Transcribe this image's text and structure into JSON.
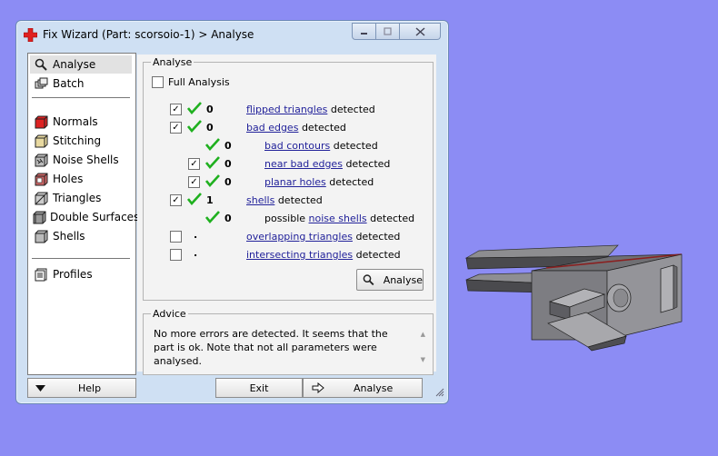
{
  "window": {
    "title": "Fix Wizard (Part: scorsoio-1) > Analyse",
    "controls": {
      "minimize": "minimize-icon",
      "maximize": "maximize-icon",
      "close": "close-icon"
    },
    "title_icon": "red-cross-icon"
  },
  "sidebar": {
    "items": [
      {
        "label": "Analyse",
        "icon": "search-icon",
        "active": true
      },
      {
        "label": "Batch",
        "icon": "batch-icon"
      },
      {
        "label": "Normals",
        "icon": "normals-cube-icon"
      },
      {
        "label": "Stitching",
        "icon": "stitching-cube-icon"
      },
      {
        "label": "Noise Shells",
        "icon": "noise-shells-icon"
      },
      {
        "label": "Holes",
        "icon": "holes-cube-icon"
      },
      {
        "label": "Triangles",
        "icon": "triangles-cube-icon"
      },
      {
        "label": "Double Surfaces",
        "icon": "double-surfaces-icon"
      },
      {
        "label": "Shells",
        "icon": "shells-cube-icon"
      },
      {
        "label": "Profiles",
        "icon": "profiles-icon"
      }
    ]
  },
  "analyse": {
    "group_label": "Analyse",
    "full_analysis_label": "Full Analysis",
    "full_analysis_checked": false,
    "rows": [
      {
        "checked": true,
        "status": "ok",
        "count": "0",
        "link": "flipped triangles",
        "suffix": "detected"
      },
      {
        "checked": true,
        "status": "ok",
        "count": "0",
        "link": "bad edges",
        "suffix": "detected"
      },
      {
        "checked": null,
        "status": "ok",
        "count": "0",
        "link": "bad contours",
        "suffix": "detected"
      },
      {
        "checked": true,
        "status": "ok",
        "count": "0",
        "link": "near bad edges",
        "suffix": "detected"
      },
      {
        "checked": true,
        "status": "ok",
        "count": "0",
        "link": "planar holes",
        "suffix": "detected"
      },
      {
        "checked": true,
        "status": "ok",
        "count": "1",
        "link": "shells",
        "suffix": "detected"
      },
      {
        "checked": null,
        "status": "ok",
        "count": "0",
        "prefix": "possible",
        "link": "noise shells",
        "suffix": "detected"
      },
      {
        "checked": false,
        "status": "none",
        "count": ".",
        "link": "overlapping triangles",
        "suffix": "detected"
      },
      {
        "checked": false,
        "status": "none",
        "count": ".",
        "link": "intersecting triangles",
        "suffix": "detected"
      }
    ],
    "analyse_button": "Analyse"
  },
  "advice": {
    "group_label": "Advice",
    "text": "No more errors are detected. It seems that the part is ok. Note that not all parameters were analysed."
  },
  "bottom": {
    "help": "Help",
    "exit": "Exit",
    "analyse": "Analyse"
  },
  "colors": {
    "desktop": "#8c8cf4",
    "check_green": "#1fb01f",
    "link": "#22229a",
    "red_cross": "#e02020"
  }
}
